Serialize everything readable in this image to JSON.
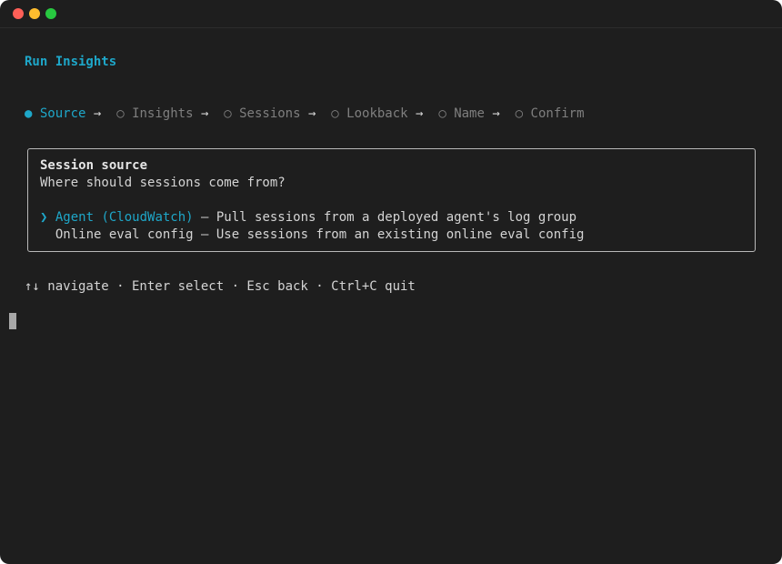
{
  "window": {
    "traffic_lights": [
      "close",
      "minimize",
      "maximize"
    ]
  },
  "header": {
    "title": "Run Insights"
  },
  "stepper": {
    "steps": [
      {
        "marker": "●",
        "label": "Source",
        "active": true
      },
      {
        "marker": "○",
        "label": "Insights",
        "active": false
      },
      {
        "marker": "○",
        "label": "Sessions",
        "active": false
      },
      {
        "marker": "○",
        "label": "Lookback",
        "active": false
      },
      {
        "marker": "○",
        "label": "Name",
        "active": false
      },
      {
        "marker": "○",
        "label": "Confirm",
        "active": false
      }
    ],
    "separator": "→"
  },
  "panel": {
    "title": "Session source",
    "question": "Where should sessions come from?",
    "pointer": "❯",
    "options": [
      {
        "name": "Agent (CloudWatch)",
        "desc": " — Pull sessions from a deployed agent's log group",
        "selected": true
      },
      {
        "name": "Online eval config",
        "desc": " — Use sessions from an existing online eval config",
        "selected": false
      }
    ]
  },
  "footer": {
    "help": "↑↓ navigate · Enter select · Esc back · Ctrl+C quit"
  },
  "colors": {
    "accent": "#1ea7c9",
    "background": "#1e1e1e",
    "muted": "#7f7f7f",
    "text": "#d4d4d4"
  }
}
